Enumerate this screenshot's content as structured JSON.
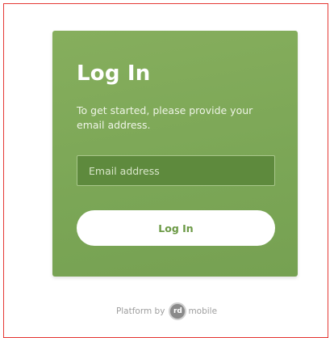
{
  "login_card": {
    "title": "Log In",
    "subtitle": "To get started, please provide your email address.",
    "email_placeholder": "Email address",
    "email_value": "",
    "submit_label": "Log In",
    "colors": {
      "card": "#7ba656",
      "input": "#5e8a3d",
      "button_text": "#6c9a46"
    }
  },
  "footer": {
    "platform_label": "Platform by",
    "brand_mark": "rd",
    "brand_word": "mobile"
  }
}
